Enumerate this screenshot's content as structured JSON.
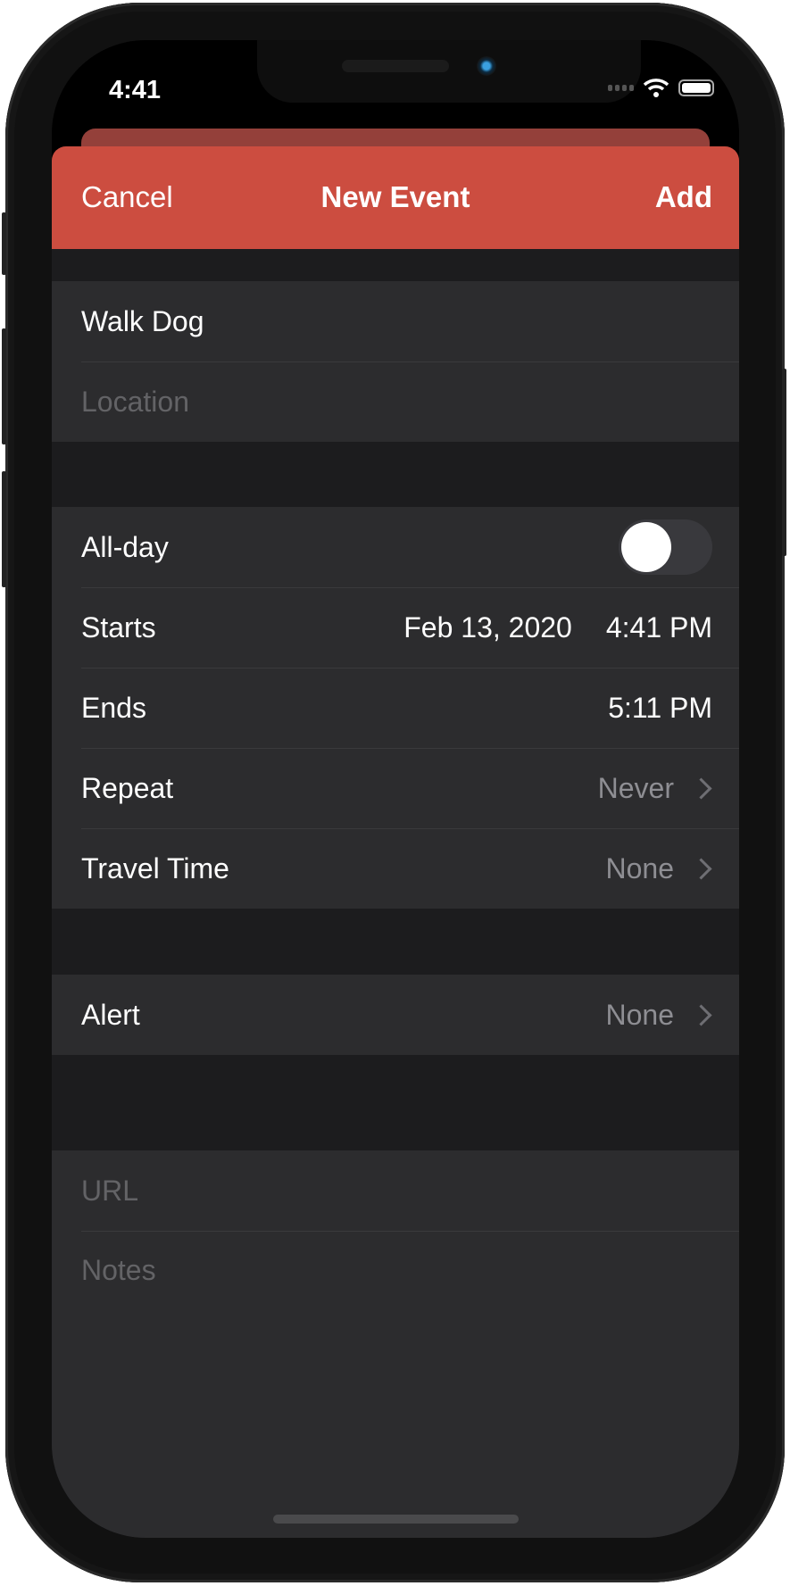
{
  "status_bar": {
    "time": "4:41",
    "icons": [
      "cellular-icon",
      "wifi-icon",
      "battery-icon"
    ]
  },
  "nav": {
    "cancel": "Cancel",
    "title": "New Event",
    "add": "Add",
    "accent": "#cc4d40"
  },
  "title_field": {
    "value": "Walk Dog"
  },
  "location_field": {
    "placeholder": "Location"
  },
  "all_day": {
    "label": "All-day",
    "on": false
  },
  "starts": {
    "label": "Starts",
    "date": "Feb 13, 2020",
    "time": "4:41 PM"
  },
  "ends": {
    "label": "Ends",
    "time": "5:11 PM"
  },
  "repeat": {
    "label": "Repeat",
    "value": "Never"
  },
  "travel_time": {
    "label": "Travel Time",
    "value": "None"
  },
  "alert": {
    "label": "Alert",
    "value": "None"
  },
  "url_field": {
    "placeholder": "URL"
  },
  "notes_field": {
    "placeholder": "Notes"
  }
}
